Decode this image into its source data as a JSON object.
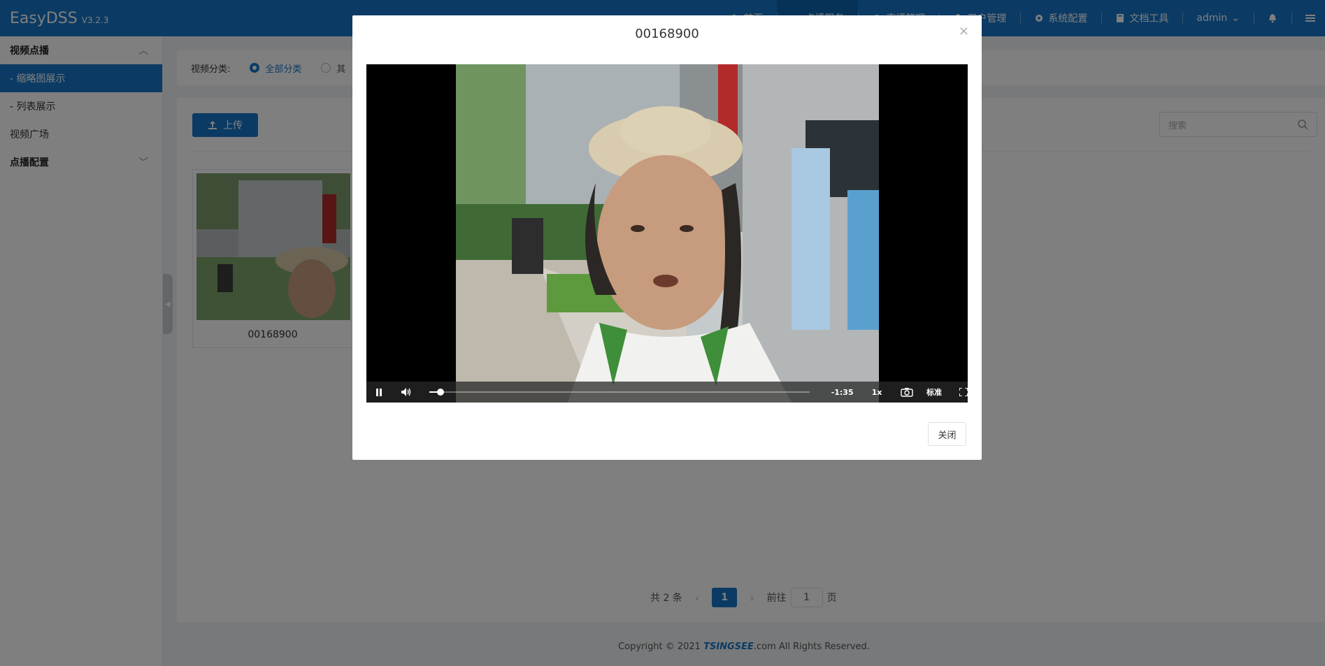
{
  "header": {
    "brand": "EasyDSS",
    "version": "V3.2.3",
    "nav": [
      {
        "label": "首页",
        "icon": "home-icon"
      },
      {
        "label": "点播服务",
        "icon": "video-icon",
        "active": true
      },
      {
        "label": "直播管理",
        "icon": "live-icon"
      },
      {
        "label": "用户管理",
        "icon": "user-icon"
      },
      {
        "label": "系统配置",
        "icon": "gear-icon"
      },
      {
        "label": "文档工具",
        "icon": "book-icon"
      }
    ],
    "user": "admin"
  },
  "sidebar": {
    "group_vod": "视频点播",
    "items": [
      {
        "label": "- 缩略图展示",
        "active": true
      },
      {
        "label": "- 列表展示"
      },
      {
        "label": "视频广场"
      }
    ],
    "group_config": "点播配置"
  },
  "filter": {
    "label": "视频分类:",
    "option_all": "全部分类",
    "option_other": "其"
  },
  "toolbar": {
    "upload_label": "上传",
    "search_placeholder": "搜索"
  },
  "videos": [
    {
      "title": "00168900"
    }
  ],
  "pagination": {
    "total_text": "共 2 条",
    "current_page": "1",
    "goto_prefix": "前往",
    "goto_value": "1",
    "goto_suffix": "页"
  },
  "footer": {
    "prefix": "Copyright © 2021 ",
    "logo": "TSINGSEE",
    "suffix": ".com All Rights Reserved."
  },
  "modal": {
    "title": "00168900",
    "close_label": "关闭",
    "player": {
      "time_remaining": "-1:35",
      "speed": "1x",
      "quality": "标准",
      "progress": 0.03
    }
  },
  "colors": {
    "primary": "#1677c9"
  }
}
